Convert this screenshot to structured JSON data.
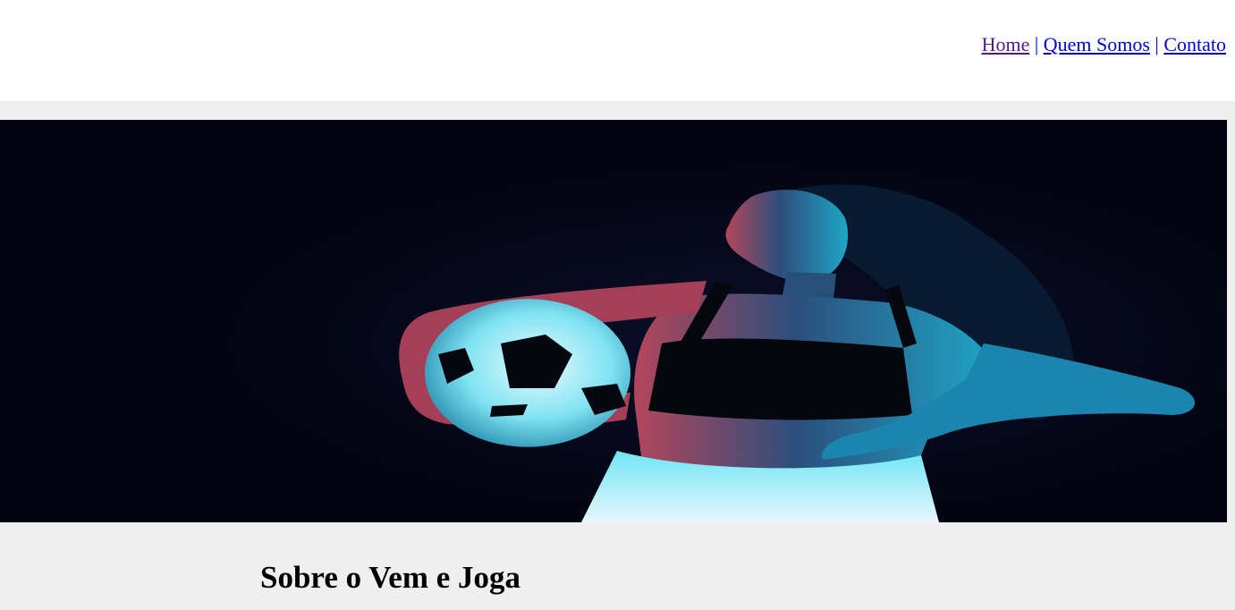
{
  "nav": {
    "items": [
      {
        "label": "Home",
        "separator": "|"
      },
      {
        "label": "Quem Somos",
        "separator": "|"
      },
      {
        "label": "Contato",
        "separator": ""
      }
    ]
  },
  "hero": {
    "image": "woman-holding-soccer-ball-photo",
    "colors": {
      "background": "#02030e",
      "accent_cyan": "#27d6f0",
      "accent_pink": "#e0506c"
    }
  },
  "about": {
    "title": "Sobre o Vem e Joga"
  }
}
